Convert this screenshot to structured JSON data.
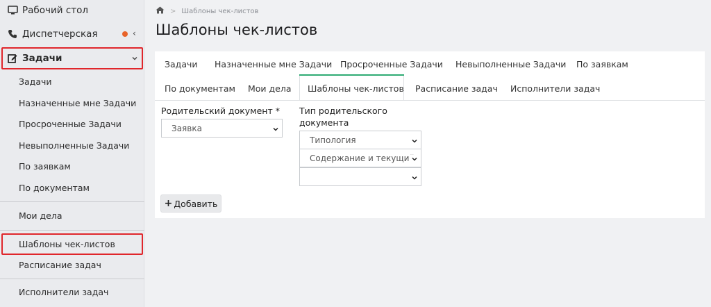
{
  "sidebar": {
    "top_items": [
      {
        "label": "Рабочий стол",
        "icon": "monitor-icon"
      },
      {
        "label": "Диспетчерская",
        "icon": "phone-icon",
        "badge_color": "#e8632a"
      },
      {
        "label": "Задачи",
        "icon": "edit-icon"
      }
    ],
    "sub_items": [
      {
        "label": "Задачи"
      },
      {
        "label": "Назначенные мне Задачи"
      },
      {
        "label": "Просроченные Задачи"
      },
      {
        "label": "Невыполненные Задачи"
      },
      {
        "label": "По заявкам"
      },
      {
        "label": "По документам"
      },
      {
        "label": "Мои дела"
      },
      {
        "label": "Шаблоны чек-листов"
      },
      {
        "label": "Расписание задач"
      },
      {
        "label": "Исполнители задач"
      }
    ],
    "highlight_color": "#e0262b"
  },
  "breadcrumb": {
    "home_icon": "home-icon",
    "separator": ">",
    "current": "Шаблоны чек-листов"
  },
  "page_title": "Шаблоны чек-листов",
  "tabs": [
    {
      "label": "Задачи"
    },
    {
      "label": "Назначенные мне Задачи"
    },
    {
      "label": "Просроченные Задачи"
    },
    {
      "label": "Невыполненные Задачи"
    },
    {
      "label": "По заявкам"
    },
    {
      "label": "По документам"
    },
    {
      "label": "Мои дела"
    },
    {
      "label": "Шаблоны чек-листов",
      "active": true
    },
    {
      "label": "Расписание задач"
    },
    {
      "label": "Исполнители задач"
    }
  ],
  "active_tab_color": "#2eab73",
  "form": {
    "parent_doc_label": "Родительский документ *",
    "parent_doc_value": "Заявка",
    "parent_type_label_line1": "Тип родительского",
    "parent_type_label_line2": "документа",
    "type_selects": [
      "Типология",
      "Содержание и текущий",
      ""
    ],
    "add_button_label": "Добавить",
    "add_button_icon": "plus-icon"
  }
}
